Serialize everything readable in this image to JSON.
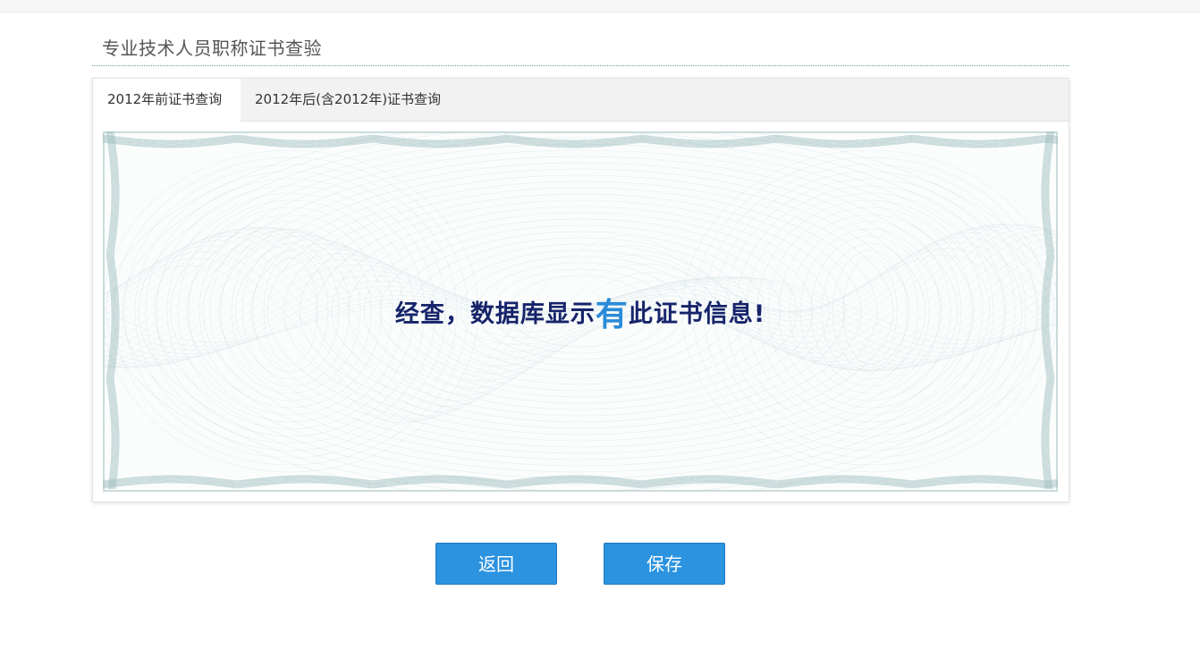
{
  "page": {
    "title": "专业技术人员职称证书查验"
  },
  "tabs": [
    {
      "label": "2012年前证书查询",
      "active": true
    },
    {
      "label": "2012年后(含2012年)证书查询",
      "active": false
    }
  ],
  "result": {
    "prefix": "经查，数据库显示",
    "highlight": "有",
    "suffix": "此证书信息!"
  },
  "buttons": {
    "back_label": "返回",
    "save_label": "保存"
  },
  "colors": {
    "primary_button": "#2b93e0",
    "result_text": "#16246a",
    "result_highlight": "#2a8bd8",
    "guilloche": "#9cbcbc"
  },
  "icons": {
    "certificate_background": "guilloche-certificate-pattern"
  }
}
